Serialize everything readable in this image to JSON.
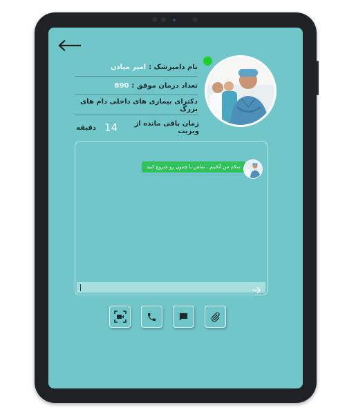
{
  "doctor": {
    "name_label": "نام  دامپزشک :",
    "name_value": "امیر میادن",
    "treatments_label": "تعداد درمان موفق :",
    "treatments_value": "890",
    "specialty": "دکترای بیماری های داخلی دام های بزرگ",
    "online_color": "#1ed02b"
  },
  "visit": {
    "time_label": "زمان باقی مانده از ویزیت",
    "minutes": "14",
    "unit": "دقیقه"
  },
  "chat": {
    "messages": [
      {
        "text": "سلام من آنلاینم . تماس با چتتون رو شروع کنید",
        "color": "#2fc25a"
      }
    ],
    "input_value": ""
  },
  "actions": [
    {
      "icon": "video-scan-icon"
    },
    {
      "icon": "phone-icon"
    },
    {
      "icon": "message-icon"
    },
    {
      "icon": "attachment-icon"
    }
  ],
  "theme": {
    "screen_bg": "#71c6c9",
    "input_bg": "#a9dedf",
    "bezel": "#1f2124"
  }
}
